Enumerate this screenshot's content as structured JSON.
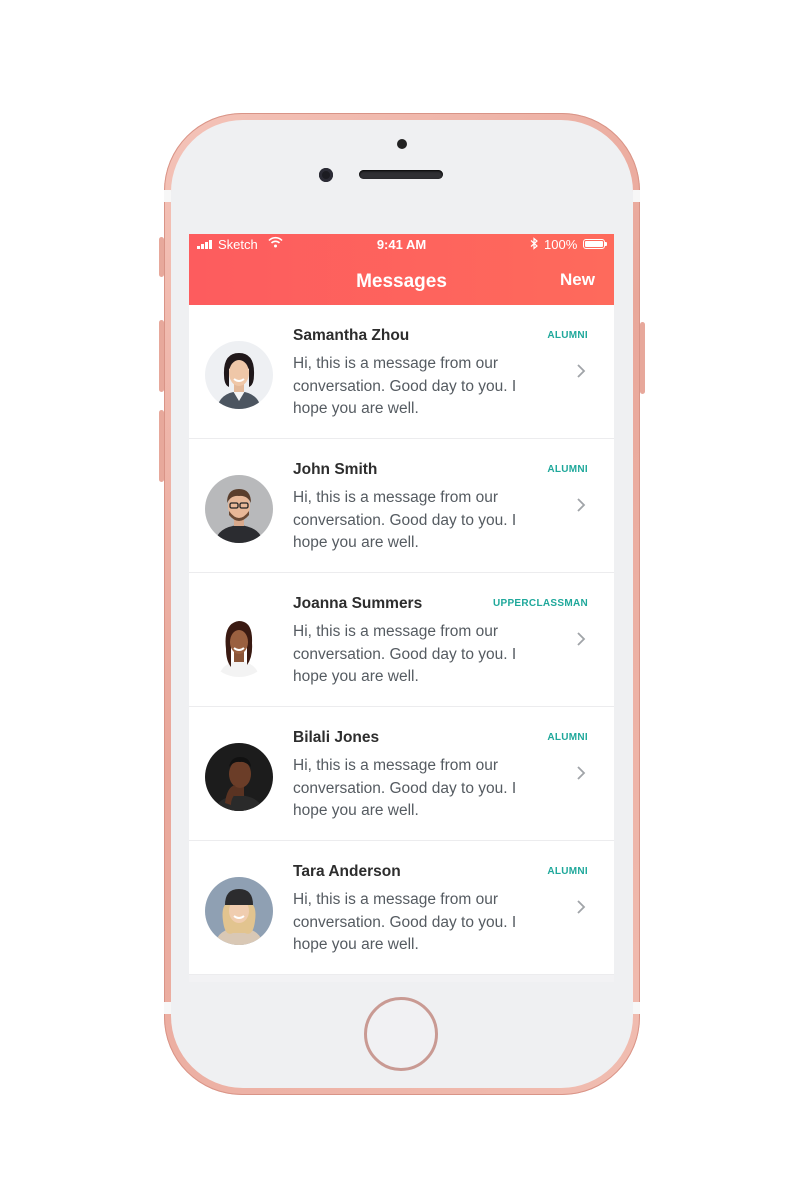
{
  "status_bar": {
    "carrier": "Sketch",
    "time": "9:41 AM",
    "battery": "100%"
  },
  "nav": {
    "title": "Messages",
    "new_label": "New"
  },
  "conversations": [
    {
      "name": "Samantha Zhou",
      "badge": "ALUMNI",
      "message": "Hi, this is a message from our conversation. Good day to you. I hope you are well."
    },
    {
      "name": "John Smith",
      "badge": "ALUMNI",
      "message": "Hi, this is a message from our conversation. Good day to you. I hope you are well."
    },
    {
      "name": "Joanna Summers",
      "badge": "UPPERCLASSMAN",
      "message": "Hi, this is a message from our conversation. Good day to you. I hope you are well."
    },
    {
      "name": "Bilali Jones",
      "badge": "ALUMNI",
      "message": "Hi, this is a message from our conversation. Good day to you. I hope you are well."
    },
    {
      "name": "Tara Anderson",
      "badge": "ALUMNI",
      "message": "Hi, this is a message from our conversation. Good day to you. I hope you are well."
    }
  ],
  "colors": {
    "header_gradient_start": "#fd5c5e",
    "header_gradient_end": "#fe6a5c",
    "badge": "#1fa89b",
    "phone_frame": "#f1b9ad"
  }
}
